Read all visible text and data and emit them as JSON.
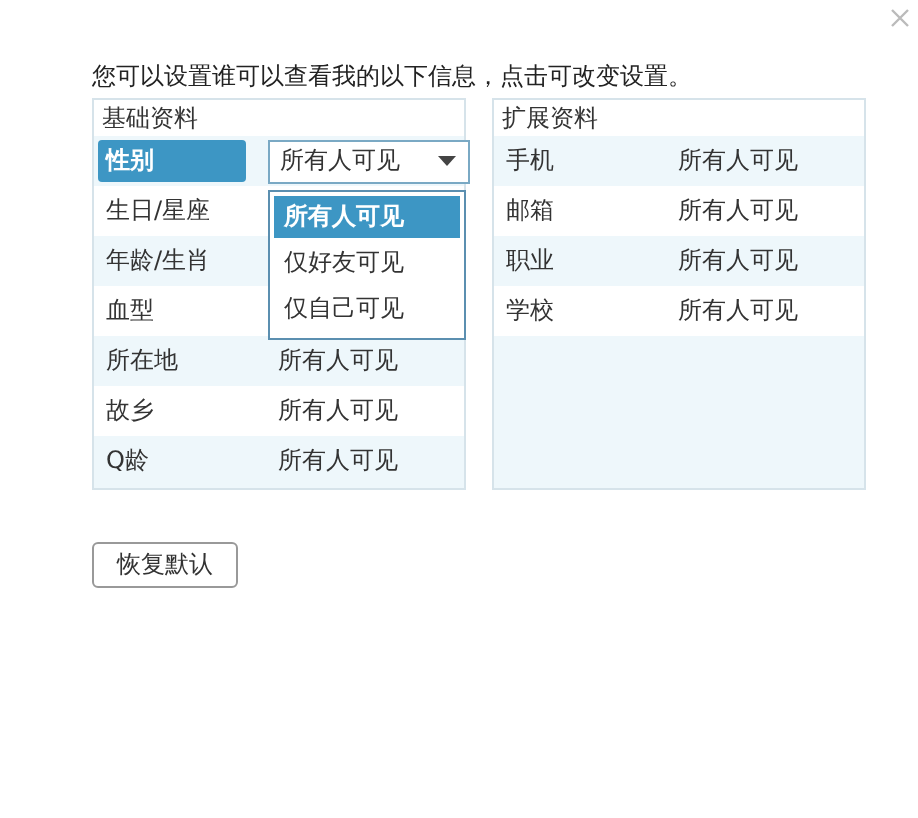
{
  "intro": "您可以设置谁可以查看我的以下信息，点击可改变设置。",
  "panels": [
    {
      "title": "基础资料",
      "rows": [
        {
          "label": "性别",
          "value": "所有人可见",
          "selected": true,
          "expanded": true,
          "options": [
            {
              "label": "所有人可见",
              "selected": true
            },
            {
              "label": "仅好友可见",
              "selected": false
            },
            {
              "label": "仅自己可见",
              "selected": false
            }
          ]
        },
        {
          "label": "生日/星座",
          "selected": false
        },
        {
          "label": "年龄/生肖",
          "selected": false
        },
        {
          "label": "血型",
          "selected": false
        },
        {
          "label": "所在地",
          "value": "所有人可见",
          "selected": false
        },
        {
          "label": "故乡",
          "value": "所有人可见",
          "selected": false
        },
        {
          "label": "Q龄",
          "value": "所有人可见",
          "selected": false
        }
      ]
    },
    {
      "title": "扩展资料",
      "rows": [
        {
          "label": "手机",
          "value": "所有人可见",
          "selected": false
        },
        {
          "label": "邮箱",
          "value": "所有人可见",
          "selected": false
        },
        {
          "label": "职业",
          "value": "所有人可见",
          "selected": false
        },
        {
          "label": "学校",
          "value": "所有人可见",
          "selected": false
        }
      ]
    }
  ],
  "buttons": [
    "恢复默认"
  ]
}
